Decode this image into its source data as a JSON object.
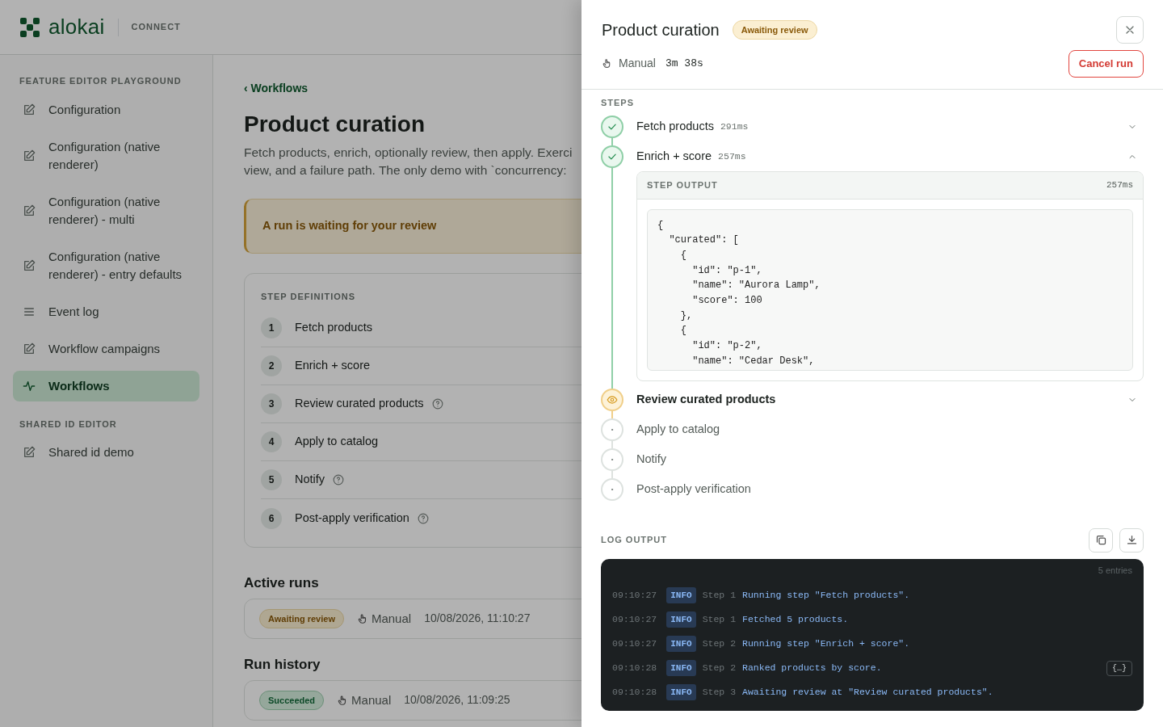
{
  "brand": {
    "name": "alokai",
    "product": "CONNECT"
  },
  "sidebar": {
    "groups": [
      {
        "title": "FEATURE EDITOR PLAYGROUND",
        "items": [
          {
            "label": "Configuration",
            "kind": "edit",
            "selected": false
          },
          {
            "label": "Configuration (native renderer)",
            "kind": "edit",
            "selected": false
          },
          {
            "label": "Configuration (native renderer) - multi",
            "kind": "edit",
            "selected": false
          },
          {
            "label": "Configuration (native renderer) - entry defaults",
            "kind": "edit",
            "selected": false
          },
          {
            "label": "Event log",
            "kind": "log",
            "selected": false
          },
          {
            "label": "Workflow campaigns",
            "kind": "edit",
            "selected": false
          },
          {
            "label": "Workflows",
            "kind": "activity",
            "selected": true
          }
        ]
      },
      {
        "title": "SHARED ID EDITOR",
        "items": [
          {
            "label": "Shared id demo",
            "kind": "edit",
            "selected": false
          }
        ]
      }
    ]
  },
  "main": {
    "back_link": "‹ Workflows",
    "title": "Product curation",
    "description": [
      "Fetch products, enrich, optionally review, then apply. Exerci",
      "view, and a failure path. The only demo with `concurrency:"
    ],
    "alert": "A run is waiting for your review",
    "step_definitions": {
      "title": "STEP DEFINITIONS",
      "steps": [
        {
          "number": "1",
          "name": "Fetch products",
          "help": false
        },
        {
          "number": "2",
          "name": "Enrich + score",
          "help": false
        },
        {
          "number": "3",
          "name": "Review curated products",
          "help": true
        },
        {
          "number": "4",
          "name": "Apply to catalog",
          "help": false
        },
        {
          "number": "5",
          "name": "Notify",
          "help": true
        },
        {
          "number": "6",
          "name": "Post-apply verification",
          "help": true
        }
      ]
    },
    "active_runs": {
      "title": "Active runs",
      "runs": [
        {
          "status": "Awaiting review",
          "kind": "waiting",
          "trigger": "Manual",
          "time": "10/08/2026, 11:10:27"
        }
      ]
    },
    "run_history": {
      "title": "Run history",
      "runs": [
        {
          "status": "Succeeded",
          "kind": "success",
          "trigger": "Manual",
          "time": "10/08/2026, 11:09:25"
        }
      ]
    }
  },
  "drawer": {
    "title": "Product curation",
    "status": "Awaiting review",
    "trigger": "Manual",
    "duration": "3m 38s",
    "cancel_button": "Cancel run",
    "steps_title": "STEPS",
    "steps": [
      {
        "name": "Fetch products",
        "duration": "291ms",
        "kind": "done",
        "expanded": false
      },
      {
        "name": "Enrich + score",
        "duration": "257ms",
        "kind": "done",
        "expanded": true,
        "output": {
          "title": "STEP OUTPUT",
          "duration": "257ms",
          "lines": [
            "{",
            "  \"curated\": [",
            "    {",
            "      \"id\": \"p-1\",",
            "      \"name\": \"Aurora Lamp\",",
            "      \"score\": 100",
            "    },",
            "    {",
            "      \"id\": \"p-2\",",
            "      \"name\": \"Cedar Desk\","
          ]
        }
      },
      {
        "name": "Review curated products",
        "kind": "review",
        "expanded": false
      },
      {
        "name": "Apply to catalog",
        "kind": "pending"
      },
      {
        "name": "Notify",
        "kind": "pending"
      },
      {
        "name": "Post-apply verification",
        "kind": "pending"
      }
    ],
    "log": {
      "title": "LOG OUTPUT",
      "count": "5 entries",
      "entries": [
        {
          "time": "09:10:27",
          "level": "INFO",
          "step": "Step 1",
          "message": "Running step \"Fetch products\"."
        },
        {
          "time": "09:10:27",
          "level": "INFO",
          "step": "Step 1",
          "message": "Fetched 5 products."
        },
        {
          "time": "09:10:27",
          "level": "INFO",
          "step": "Step 2",
          "message": "Running step \"Enrich + score\"."
        },
        {
          "time": "09:10:28",
          "level": "INFO",
          "step": "Step 2",
          "message": "Ranked products by score.",
          "payload_button": "{…}"
        },
        {
          "time": "09:10:28",
          "level": "INFO",
          "step": "Step 3",
          "message": "Awaiting review at \"Review curated products\"."
        }
      ]
    }
  }
}
